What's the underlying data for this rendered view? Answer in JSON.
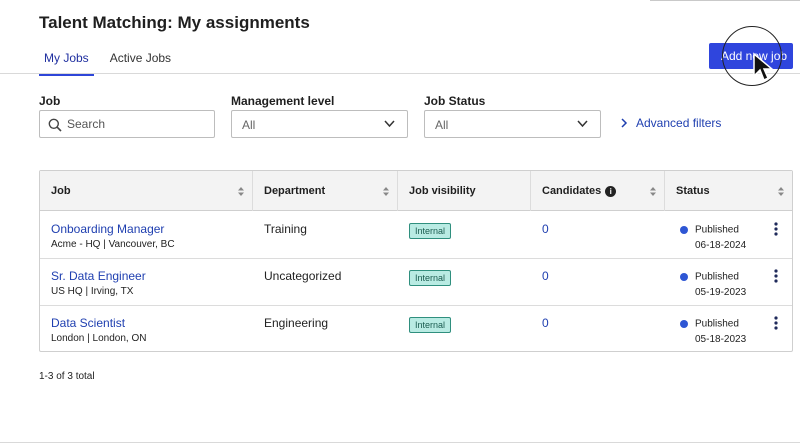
{
  "header": {
    "title": "Talent Matching: My assignments",
    "add_job_label": "Add new job"
  },
  "tabs": [
    {
      "label": "My Jobs",
      "active": true
    },
    {
      "label": "Active Jobs",
      "active": false
    }
  ],
  "filters": {
    "job_label": "Job",
    "search_placeholder": "Search",
    "management_label": "Management level",
    "management_value": "All",
    "status_label": "Job Status",
    "status_value": "All",
    "advanced_label": "Advanced filters"
  },
  "table": {
    "columns": [
      "Job",
      "Department",
      "Job visibility",
      "Candidates",
      "Status"
    ],
    "rows": [
      {
        "title": "Onboarding Manager",
        "location": "Acme - HQ  |  Vancouver, BC",
        "department": "Training",
        "visibility": "Internal",
        "candidates": "0",
        "status": "Published",
        "date": "06-18-2024"
      },
      {
        "title": "Sr. Data Engineer",
        "location": "US HQ  |  Irving, TX",
        "department": "Uncategorized",
        "visibility": "Internal",
        "candidates": "0",
        "status": "Published",
        "date": "05-19-2023"
      },
      {
        "title": "Data Scientist",
        "location": "London  |  London, ON",
        "department": "Engineering",
        "visibility": "Internal",
        "candidates": "0",
        "status": "Published",
        "date": "05-18-2023"
      }
    ]
  },
  "pager": {
    "text": "1-3 of 3 total"
  },
  "icons": {
    "search": "search-icon",
    "chevron": "chevron-down-icon",
    "advanced": "chevron-right-icon",
    "sort": "sort-icon",
    "info": "info-icon",
    "more": "kebab-menu-icon",
    "cursor": "mouse-pointer-icon"
  },
  "colors": {
    "primary": "#2f45dd",
    "link": "#1f3fb0",
    "badge_bg": "#b9ebe3",
    "status_published": "#2e56d4"
  }
}
